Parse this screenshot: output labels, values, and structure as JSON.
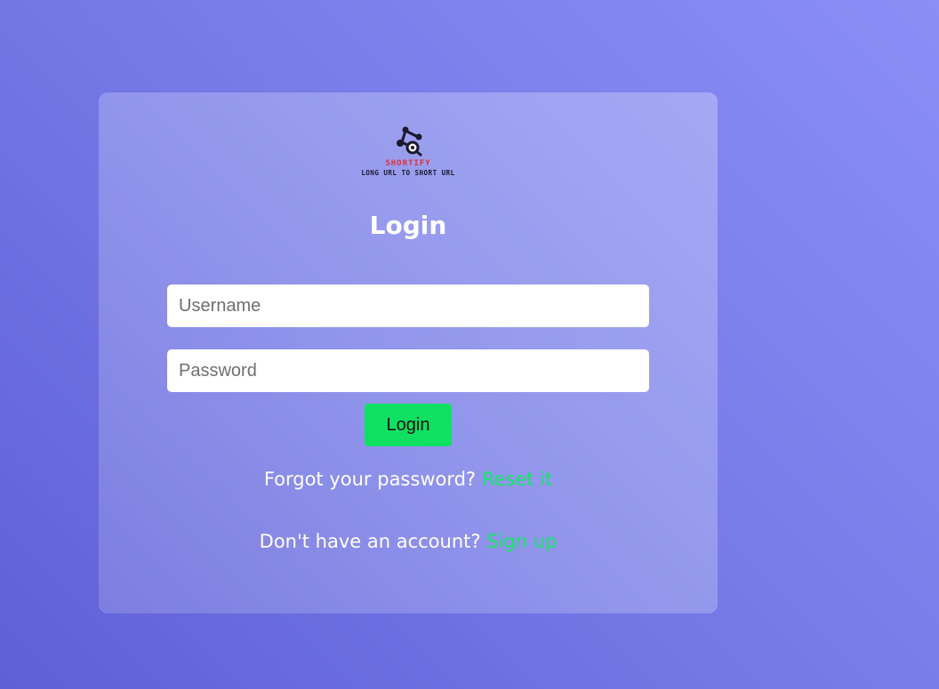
{
  "logo": {
    "brand": "SHORTIFY",
    "tagline": "LONG URL TO SHORT URL",
    "icon": "share-nodes-icon"
  },
  "form": {
    "title": "Login",
    "username_placeholder": "Username",
    "password_placeholder": "Password",
    "username_value": "",
    "password_value": "",
    "submit_label": "Login"
  },
  "links": {
    "forgot_text": "Forgot your password?",
    "forgot_link": "Reset it",
    "signup_text": "Don't have an account?",
    "signup_link": "Sign up"
  },
  "colors": {
    "accent": "#10e062",
    "link": "#12e866",
    "brand_red": "#e0303a"
  }
}
